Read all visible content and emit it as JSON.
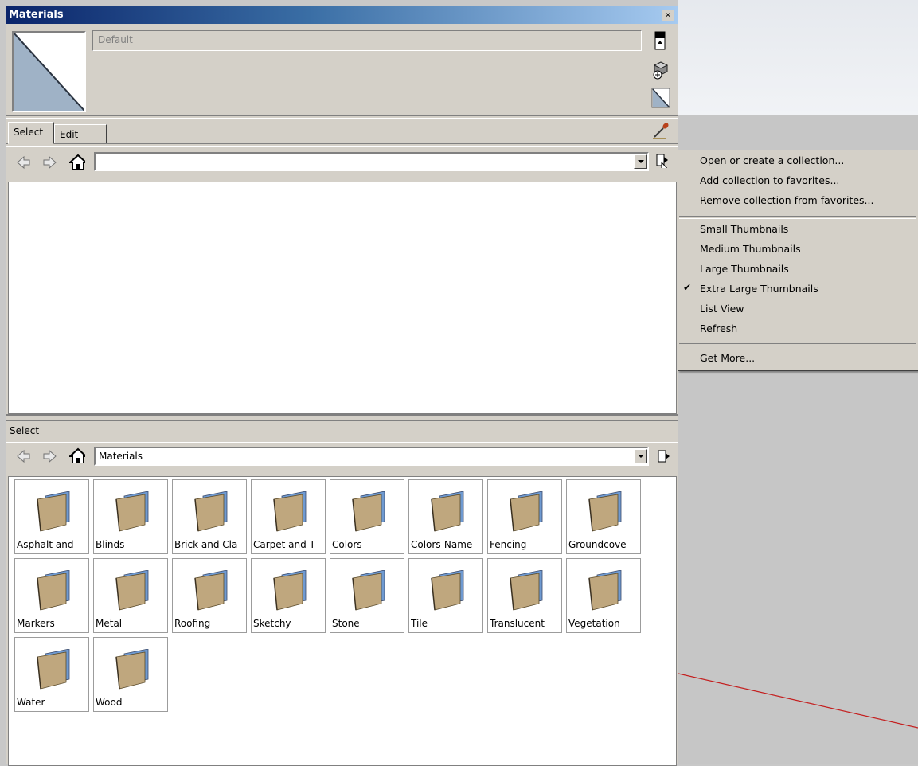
{
  "panel": {
    "title": "Materials",
    "close_glyph": "×",
    "material_name": "Default",
    "tabs": [
      {
        "label": "Select"
      },
      {
        "label": "Edit"
      }
    ],
    "top_browser": {
      "combo_value": ""
    },
    "lower_browser": {
      "label": "Select",
      "combo_value": "Materials"
    },
    "folders": [
      {
        "label": "Asphalt and"
      },
      {
        "label": "Blinds"
      },
      {
        "label": "Brick and Cla"
      },
      {
        "label": "Carpet and T"
      },
      {
        "label": "Colors"
      },
      {
        "label": "Colors-Name"
      },
      {
        "label": "Fencing"
      },
      {
        "label": "Groundcove"
      },
      {
        "label": "Markers"
      },
      {
        "label": "Metal"
      },
      {
        "label": "Roofing"
      },
      {
        "label": "Sketchy"
      },
      {
        "label": "Stone"
      },
      {
        "label": "Tile"
      },
      {
        "label": "Translucent"
      },
      {
        "label": "Vegetation"
      },
      {
        "label": "Water"
      },
      {
        "label": "Wood"
      }
    ]
  },
  "menu": {
    "items": [
      {
        "label": "Open or create a collection..."
      },
      {
        "label": "Add collection to favorites..."
      },
      {
        "label": "Remove collection from favorites..."
      },
      {
        "label": "Small Thumbnails"
      },
      {
        "label": "Medium Thumbnails"
      },
      {
        "label": "Large Thumbnails"
      },
      {
        "label": "Extra Large Thumbnails",
        "checked": true
      },
      {
        "label": "List View"
      },
      {
        "label": "Refresh"
      },
      {
        "label": "Get More..."
      }
    ],
    "check_glyph": "✔"
  },
  "colors": {
    "title_start": "#0a246a",
    "title_end": "#a6caf0",
    "swatch": "#9fb2c6",
    "folder": "#bfa77e",
    "folder_back": "#6f9ad1",
    "axis_red": "#c41e1e"
  }
}
